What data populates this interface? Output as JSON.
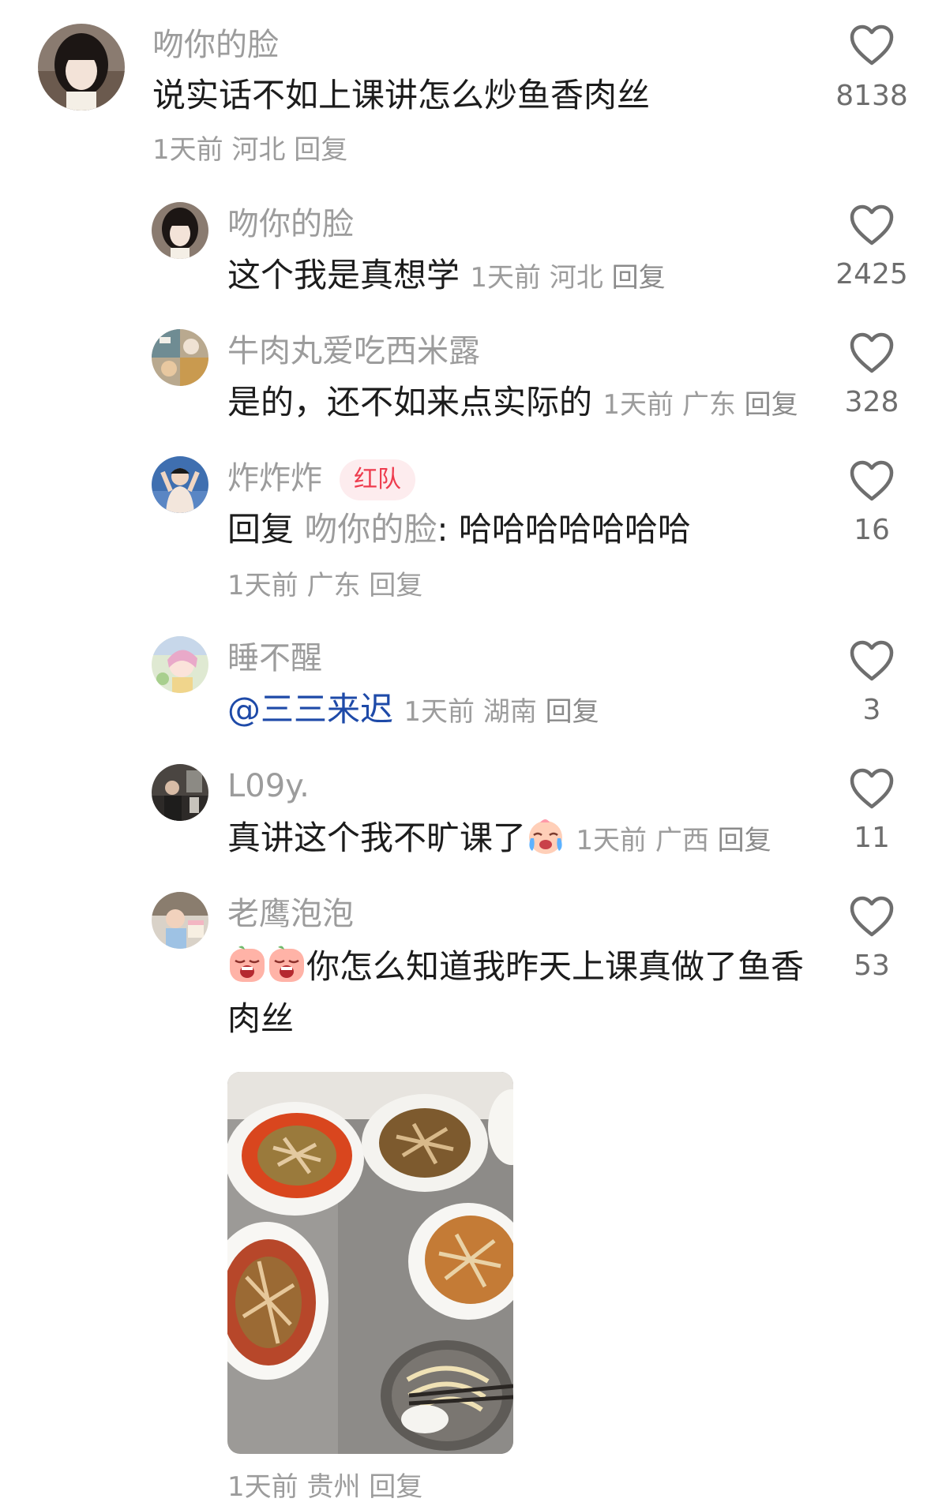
{
  "comments": [
    {
      "username": "吻你的脸",
      "text": "说实话不如上课讲怎么炒鱼香肉丝",
      "time": "1天前",
      "location": "河北",
      "reply_label": "回复",
      "likes": "8138",
      "avatar_icon": "girl-bangs-avatar"
    },
    {
      "username": "吻你的脸",
      "text": "这个我是真想学",
      "time": "1天前",
      "location": "河北",
      "reply_label": "回复",
      "likes": "2425",
      "avatar_icon": "girl-bangs-avatar"
    },
    {
      "username": "牛肉丸爱吃西米露",
      "text": "是的，还不如来点实际的",
      "time": "1天前",
      "location": "广东",
      "reply_label": "回复",
      "likes": "328",
      "avatar_icon": "collage-avatar"
    },
    {
      "username": "炸炸炸",
      "badge": "红队",
      "reply_prefix": "回复",
      "reply_to": "吻你的脸",
      "text": ": 哈哈哈哈哈哈哈",
      "time": "1天前",
      "location": "广东",
      "reply_label": "回复",
      "likes": "16",
      "avatar_icon": "sky-person-avatar"
    },
    {
      "username": "睡不醒",
      "mention": "@三三来迟",
      "time": "1天前",
      "location": "湖南",
      "reply_label": "回复",
      "likes": "3",
      "avatar_icon": "anime-girl-avatar"
    },
    {
      "username": "L09y.",
      "text": "真讲这个我不旷课了",
      "emoji": "crying-laughing-face-emoji",
      "time": "1天前",
      "location": "广西",
      "reply_label": "回复",
      "likes": "11",
      "avatar_icon": "street-photo-avatar"
    },
    {
      "username": "老鹰泡泡",
      "emoji": "crying-face-emoji",
      "text": "你怎么知道我昨天上课真做了鱼香肉丝",
      "image": "shredded-pork-dishes-photo",
      "time": "1天前",
      "location": "贵州",
      "reply_label": "回复",
      "likes": "53",
      "avatar_icon": "baby-cake-avatar"
    }
  ],
  "colors": {
    "username": "#9c9c9c",
    "text": "#1c1c1c",
    "mention": "#1e4aa8",
    "badge_bg": "#fdecee",
    "badge_text": "#ee3c4e",
    "heart": "#6e6e6e"
  }
}
